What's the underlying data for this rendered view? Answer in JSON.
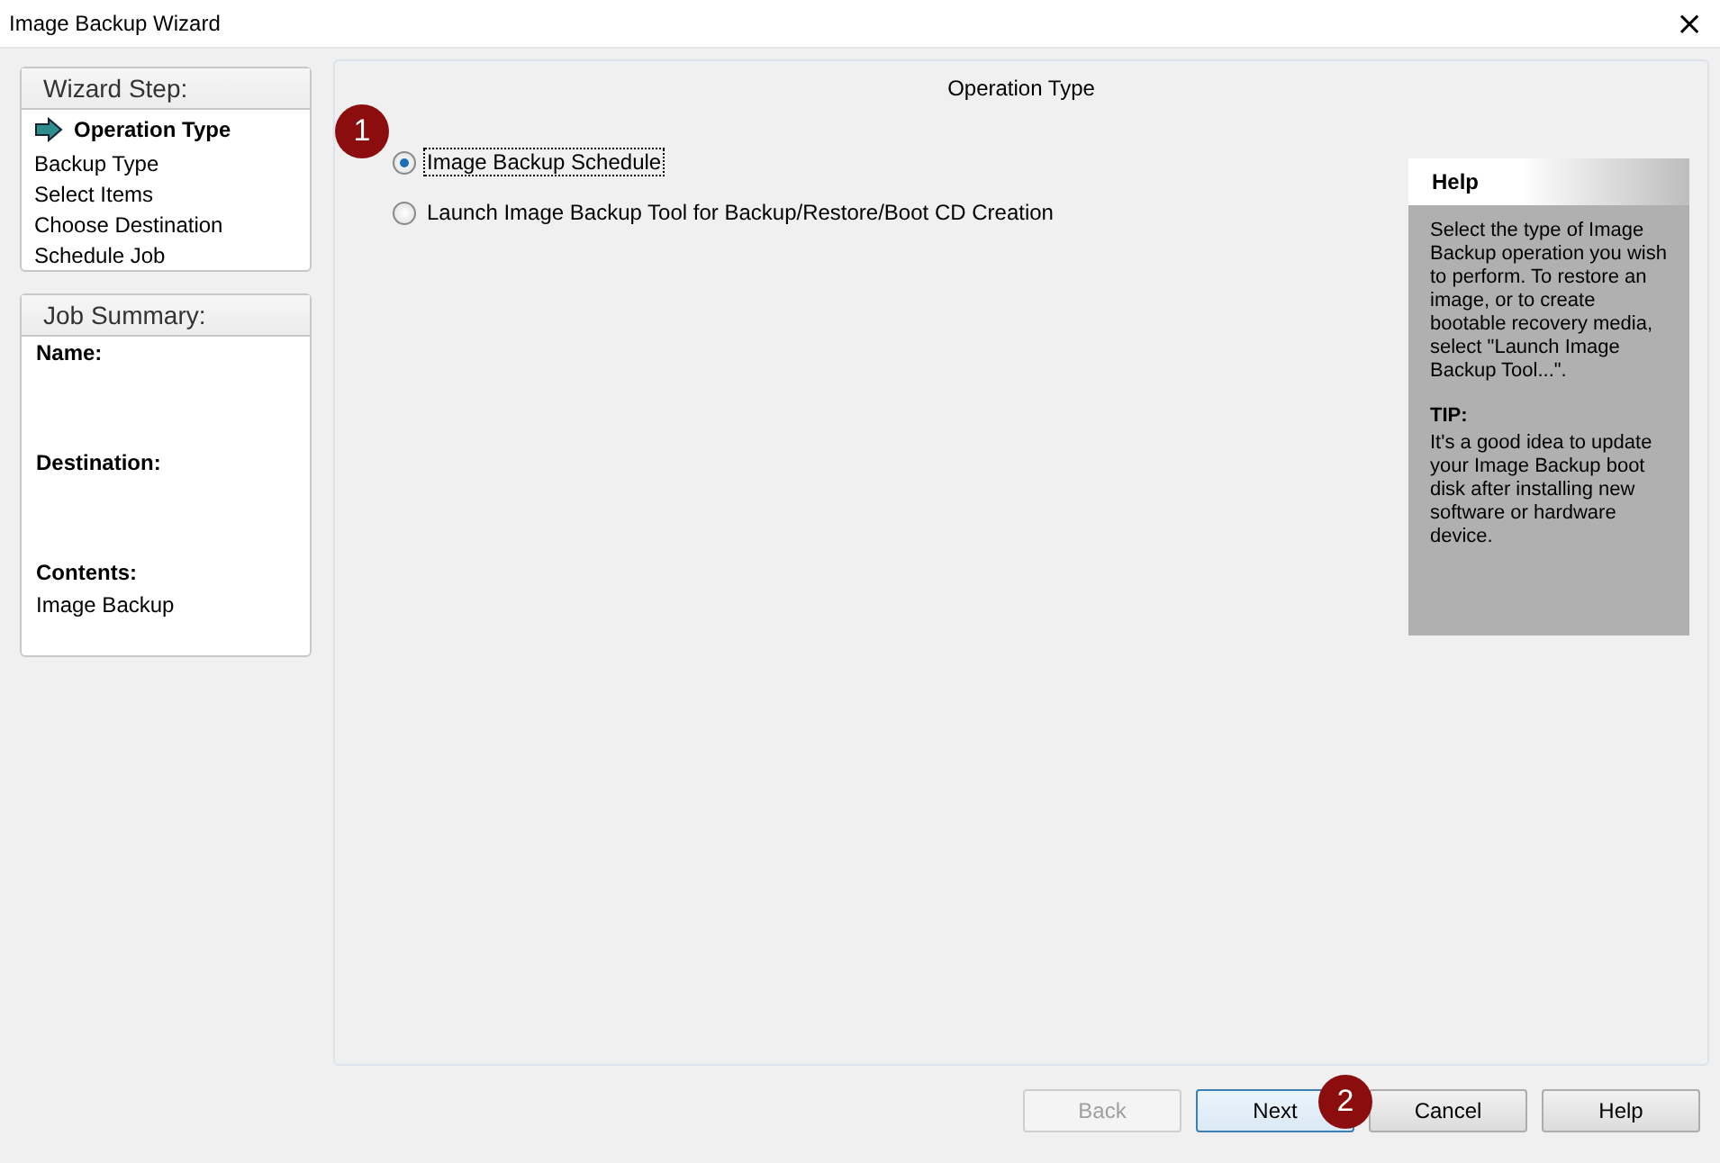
{
  "window": {
    "title": "Image Backup Wizard",
    "close": "×"
  },
  "wizard_steps": {
    "heading": "Wizard Step:",
    "items": [
      {
        "label": "Operation Type",
        "selected": true
      },
      {
        "label": "Backup Type",
        "selected": false
      },
      {
        "label": "Select Items",
        "selected": false
      },
      {
        "label": "Choose Destination",
        "selected": false
      },
      {
        "label": "Schedule Job",
        "selected": false
      }
    ]
  },
  "job_summary": {
    "heading": "Job Summary:",
    "fields": [
      {
        "label": "Name:"
      },
      {
        "label": "Destination:"
      },
      {
        "label": "Contents:",
        "value": "Image Backup"
      }
    ]
  },
  "operation": {
    "heading": "Operation Type",
    "options": [
      {
        "label": "Image Backup Schedule",
        "selected": true
      },
      {
        "label": "Launch Image Backup Tool for Backup/Restore/Boot CD Creation",
        "selected": false
      }
    ]
  },
  "help": {
    "heading": "Help",
    "body": "Select the type of Image Backup operation you wish to perform.  To restore an image, or to create bootable recovery media, select \"Launch Image Backup Tool...\".",
    "tip_heading": "TIP:",
    "tip": "It's a good idea to update your Image Backup boot disk after installing new software or hardware device."
  },
  "buttons": [
    {
      "label": "Back",
      "disabled": true,
      "focused": false
    },
    {
      "label": "Next",
      "disabled": false,
      "focused": true
    },
    {
      "label": "Cancel",
      "disabled": false,
      "focused": false
    },
    {
      "label": "Help",
      "disabled": false,
      "focused": false
    }
  ],
  "callouts": [
    {
      "label": "1"
    },
    {
      "label": "2"
    }
  ]
}
